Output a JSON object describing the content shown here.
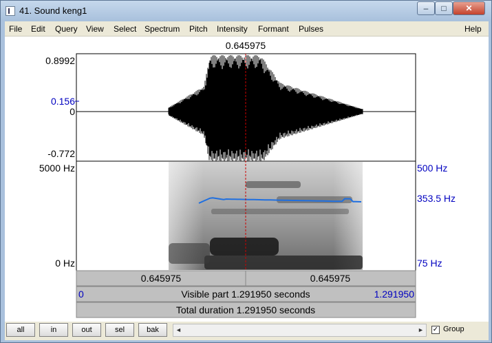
{
  "window": {
    "title": "41. Sound keng1",
    "min_glyph": "–",
    "max_glyph": "□",
    "close_glyph": "✕"
  },
  "menu": [
    "File",
    "Edit",
    "Query",
    "View",
    "Select",
    "Spectrum",
    "Pitch",
    "Intensity",
    "Formant",
    "Pulses",
    "Help"
  ],
  "cursor": {
    "time_label": "0.645975",
    "left_label": "0.645975",
    "right_label": "0.645975"
  },
  "waveform": {
    "y_max_label": "0.8992",
    "y_cursor_label": "0.156",
    "y_zero_label": "0",
    "y_min_label": "-0.772"
  },
  "spectrogram": {
    "top_label": "5000 Hz",
    "bottom_label": "0 Hz",
    "pitch_top_label": "500 Hz",
    "pitch_value_label": "353.5 Hz",
    "pitch_bottom_label": "75 Hz"
  },
  "visible": {
    "start_label": "0",
    "text": "Visible part 1.291950 seconds",
    "end_label": "1.291950"
  },
  "total": {
    "text": "Total duration 1.291950 seconds"
  },
  "toolbar": {
    "buttons": [
      "all",
      "in",
      "out",
      "sel",
      "bak"
    ],
    "group_label": "Group",
    "group_checked": true,
    "check_glyph": "✓",
    "left_arrow": "◄",
    "right_arrow": "►"
  },
  "colors": {
    "cursor": "#cc0000",
    "pitch_track": "#1f6fe0",
    "label_blue": "#0000c0",
    "info_bar": "#c0c0c0"
  }
}
